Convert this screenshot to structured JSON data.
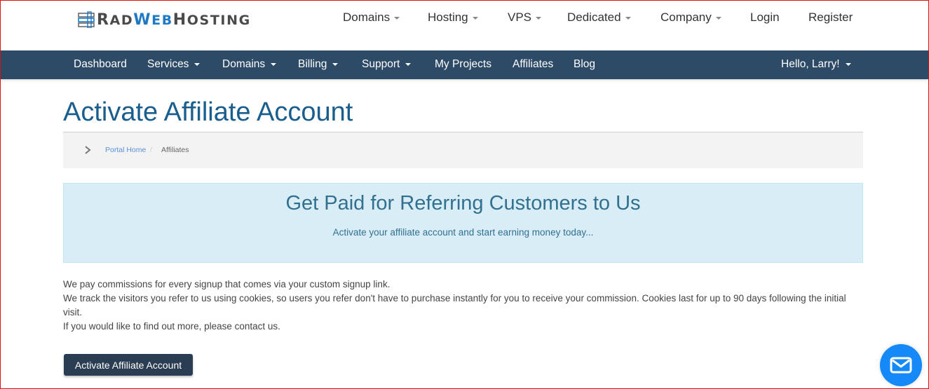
{
  "brand": {
    "name_parts": [
      "R",
      "AD",
      "W",
      "EB",
      "H",
      "OSTING"
    ],
    "accent_color": "#1f7ac4"
  },
  "topnav": {
    "items": [
      {
        "label": "Domains",
        "dropdown": true
      },
      {
        "label": "Hosting",
        "dropdown": true
      },
      {
        "label": "VPS",
        "dropdown": true
      },
      {
        "label": "Dedicated",
        "dropdown": true
      },
      {
        "label": "Company",
        "dropdown": true
      },
      {
        "label": "Login",
        "dropdown": false
      },
      {
        "label": "Register",
        "dropdown": false
      }
    ]
  },
  "mainnav": {
    "items": [
      {
        "label": "Dashboard",
        "dropdown": false
      },
      {
        "label": "Services",
        "dropdown": true
      },
      {
        "label": "Domains",
        "dropdown": true
      },
      {
        "label": "Billing",
        "dropdown": true
      },
      {
        "label": "Support",
        "dropdown": true
      },
      {
        "label": "My Projects",
        "dropdown": false
      },
      {
        "label": "Affiliates",
        "dropdown": false
      },
      {
        "label": "Blog",
        "dropdown": false
      }
    ],
    "user_menu": "Hello, Larry!",
    "bg_color": "#2d4a66"
  },
  "page": {
    "title": "Activate Affiliate Account",
    "breadcrumb": {
      "home": "Portal Home",
      "separator": "/",
      "current": "Affiliates"
    }
  },
  "hero": {
    "title": "Get Paid for Referring Customers to Us",
    "subtitle": "Activate your affiliate account and start earning money today..."
  },
  "body": {
    "lines": [
      "We pay commissions for every signup that comes via your custom signup link.",
      "We track the visitors you refer to us using cookies, so users you refer don't have to purchase instantly for you to receive your commission. Cookies last for up to 90 days following the initial visit.",
      "If you would like to find out more, please contact us."
    ]
  },
  "actions": {
    "activate_label": "Activate Affiliate Account"
  },
  "chat": {
    "icon": "envelope-icon",
    "color": "#1589f8"
  }
}
